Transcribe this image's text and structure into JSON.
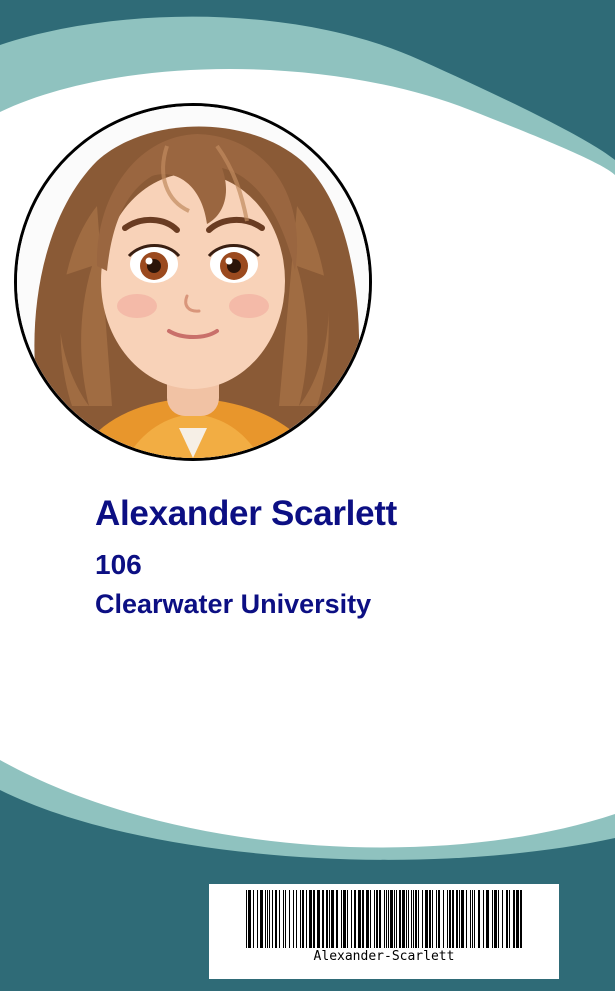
{
  "card": {
    "name": "Alexander Scarlett",
    "id_number": "106",
    "institution": "Clearwater University",
    "barcode_text": "Alexander-Scarlett"
  },
  "colors": {
    "dark_teal": "#2f6b77",
    "light_teal": "#8fc2bf",
    "panel": "#ffffff",
    "text": "#0c0f83"
  },
  "photo": {
    "subject": "cartoon girl portrait with long wavy brown hair and orange hoodie"
  }
}
